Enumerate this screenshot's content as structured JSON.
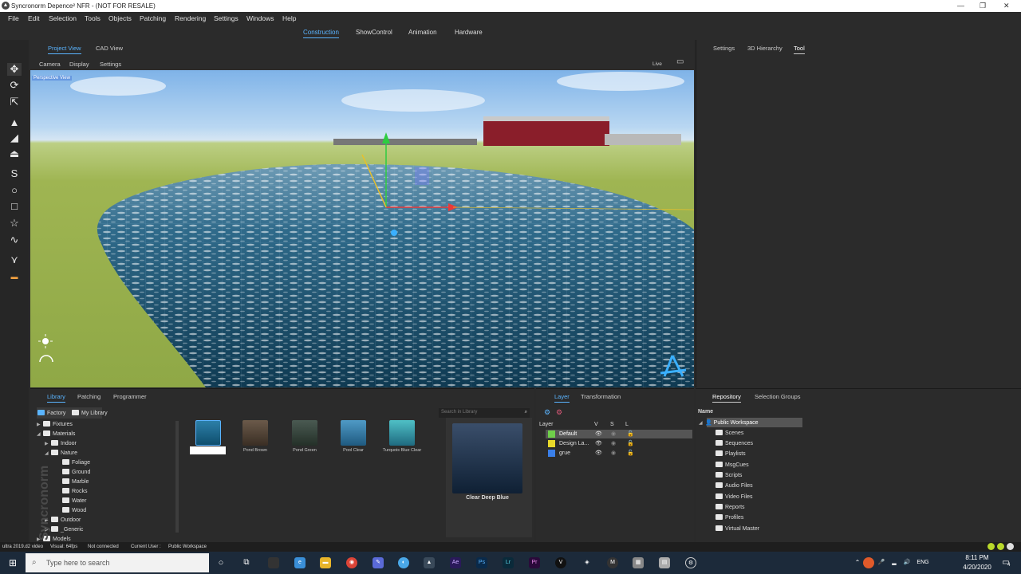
{
  "window": {
    "title": "Syncronorm Depence² NFR - (NOT FOR RESALE)"
  },
  "menu": [
    "File",
    "Edit",
    "Selection",
    "Tools",
    "Objects",
    "Patching",
    "Rendering",
    "Settings",
    "Windows",
    "Help"
  ],
  "workspace_tabs": [
    "Construction",
    "ShowControl",
    "Animation",
    "Hardware"
  ],
  "view_tabs": [
    "Project View",
    "CAD View"
  ],
  "view_subtabs": [
    "Camera",
    "Display",
    "Settings"
  ],
  "live_label": "Live",
  "viewport_label": "Perspective View",
  "right_tabs": [
    "Settings",
    "3D Hierarchy",
    "Tool"
  ],
  "library": {
    "tabs": [
      "Library",
      "Patching",
      "Programmer"
    ],
    "subtabs": [
      "Factory",
      "My Library"
    ],
    "search_placeholder": "Search in Library",
    "tree": [
      "Fixtures",
      "Materials",
      "Indoor",
      "Nature",
      "Foliage",
      "Ground",
      "Marble",
      "Rocks",
      "Water",
      "Wood",
      "Outdoor",
      "_Generic",
      "Models"
    ],
    "thumbs": [
      "",
      "Pond Brown",
      "Pond Green",
      "Pool Clear",
      "Turquois Blue Clear"
    ],
    "preview_label": "Clear Deep Blue"
  },
  "layer": {
    "tabs": [
      "Layer",
      "Transformation"
    ],
    "headers": [
      "Layer",
      "V",
      "S",
      "L"
    ],
    "rows": [
      {
        "name": "Default",
        "color": "#6fcf4a"
      },
      {
        "name": "Design La...",
        "color": "#e8d92a"
      },
      {
        "name": "grue",
        "color": "#3a7fe8"
      }
    ]
  },
  "repository": {
    "tabs": [
      "Repository",
      "Selection Groups"
    ],
    "header": "Name",
    "root": "Public Workspace",
    "items": [
      "Scenes",
      "Sequences",
      "Playlists",
      "MsgCues",
      "Scripts",
      "Audio Files",
      "Video Files",
      "Reports",
      "Profiles",
      "Virtual Master"
    ]
  },
  "watermark": "Syncronorm",
  "status": {
    "version": "ultra 2019.d2 video",
    "fps": "Visual: 64fps",
    "connection": "Not connected",
    "user_label": "Current User :",
    "user": "Public Workspace"
  },
  "taskbar": {
    "search_placeholder": "Type here to search",
    "lang": "ENG",
    "time": "8:11 PM",
    "date": "4/20/2020",
    "notifications": "4"
  }
}
